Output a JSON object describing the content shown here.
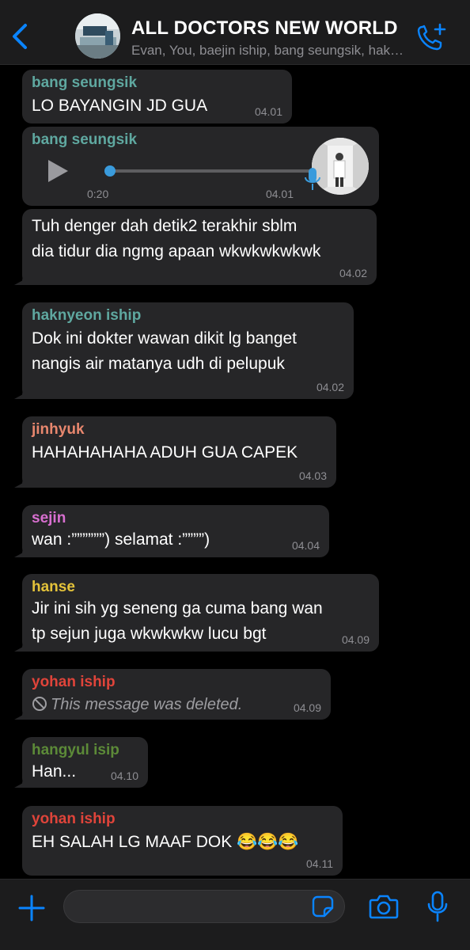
{
  "colors": {
    "accent": "#0a84ff",
    "bubble": "#262628",
    "header": "#1c1c1d"
  },
  "header": {
    "title": "ALL DOCTORS NEW WORLD",
    "subtitle": "Evan, You, baejin iship, bang seungsik, haknyeon iship",
    "icons": [
      "chevron-left-icon",
      "add-call-icon"
    ]
  },
  "messages": [
    {
      "sender": "bang seungsik",
      "sender_color": "#5fa8a0",
      "text": "LO BAYANGIN JD GUA",
      "time": "04.01"
    },
    {
      "sender": "bang seungsik",
      "sender_color": "#5fa8a0",
      "type": "voice",
      "duration": "0:20",
      "time": "04.01"
    },
    {
      "lines": [
        "Tuh denger dah detik2 terakhir sblm",
        "dia tidur dia ngmg apaan wkwkwkwkwk"
      ],
      "time": "04.02"
    },
    {
      "sender": "haknyeon iship",
      "sender_color": "#5fa8a0",
      "lines": [
        "Dok ini dokter wawan dikit lg banget",
        "nangis air matanya udh di pelupuk"
      ],
      "time": "04.02"
    },
    {
      "sender": "jinhyuk",
      "sender_color": "#e8876e",
      "text": "HAHAHAHAHA ADUH GUA CAPEK",
      "time": "04.03"
    },
    {
      "sender": "sejin",
      "sender_color": "#d86fd0",
      "text": "wan :””””””) selamat :””””)",
      "time": "04.04"
    },
    {
      "sender": "hanse",
      "sender_color": "#e3c23a",
      "lines": [
        "Jir ini sih yg seneng ga cuma bang wan",
        "tp sejun juga wkwkwkw lucu bgt"
      ],
      "time": "04.09"
    },
    {
      "sender": "yohan iship",
      "sender_color": "#e0443a",
      "deleted_text": "This message was deleted.",
      "time": "04.09"
    },
    {
      "sender": "hangyul isip",
      "sender_color": "#5c8a38",
      "text": "Han...",
      "time": "04.10"
    },
    {
      "sender": "yohan iship",
      "sender_color": "#e0443a",
      "text": "EH SALAH LG MAAF DOK 😂😂😂",
      "time": "04.11"
    }
  ],
  "composer": {
    "placeholder": "",
    "icons": [
      "plus-icon",
      "sticker-icon",
      "camera-icon",
      "microphone-icon"
    ]
  }
}
